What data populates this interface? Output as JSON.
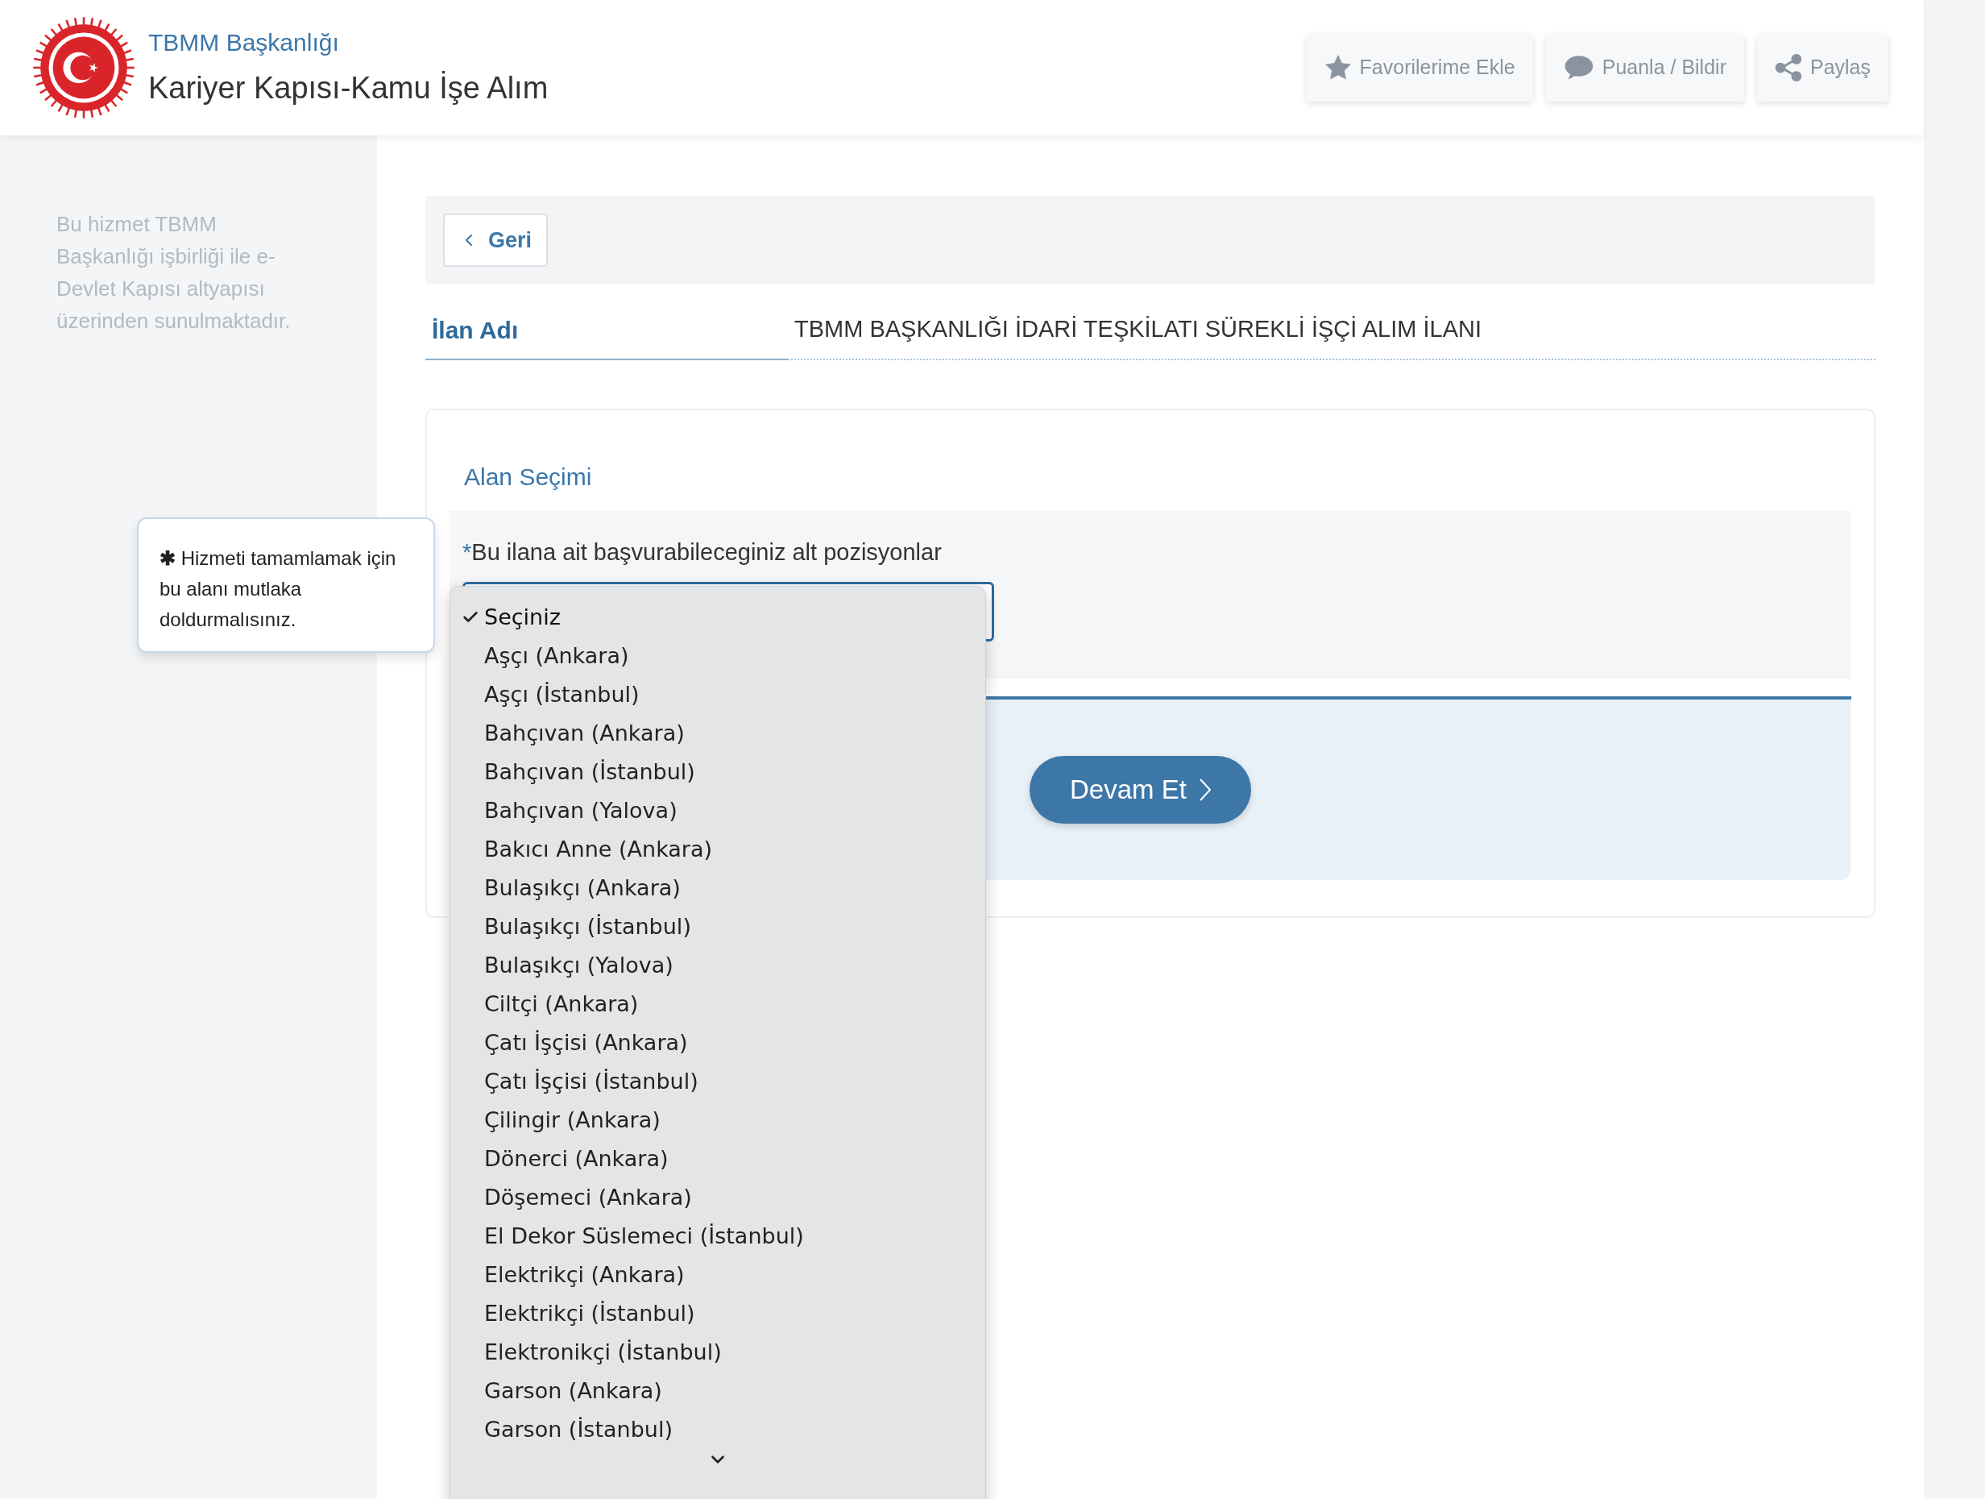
{
  "header": {
    "agency": "TBMM Başkanlığı",
    "title": "Kariyer Kapısı-Kamu İşe Alım",
    "actions": [
      {
        "label": "Favorilerime Ekle",
        "kind": "star"
      },
      {
        "label": "Puanla / Bildir",
        "kind": "comment"
      },
      {
        "label": "Paylaş",
        "kind": "share"
      }
    ]
  },
  "sidebar": {
    "note": "Bu hizmet TBMM Başkanlığı işbirliği ile e-Devlet Kapısı altyapısı üzerinden sunulmaktadır."
  },
  "back_button": {
    "label": "Geri"
  },
  "listing": {
    "label": "İlan Adı",
    "value": "TBMM BAŞKANLIĞI İDARİ TEŞKİLATI SÜREKLİ İŞÇİ ALIM İLANI"
  },
  "section": {
    "title": "Alan Seçimi",
    "required_mark": "*",
    "field_label": "Bu ilana ait başvurabileceginiz alt pozisyonlar"
  },
  "tooltip": {
    "mark": "✱",
    "text": "Hizmeti tamamlamak için bu alanı mutlaka doldurmalısınız."
  },
  "dropdown": {
    "expanded": true,
    "options": [
      {
        "label": "Seçiniz",
        "selected": true
      },
      {
        "label": "Aşçı (Ankara)",
        "selected": false
      },
      {
        "label": "Aşçı (İstanbul)",
        "selected": false
      },
      {
        "label": "Bahçıvan (Ankara)",
        "selected": false
      },
      {
        "label": "Bahçıvan (İstanbul)",
        "selected": false
      },
      {
        "label": "Bahçıvan (Yalova)",
        "selected": false
      },
      {
        "label": "Bakıcı Anne (Ankara)",
        "selected": false
      },
      {
        "label": "Bulaşıkçı (Ankara)",
        "selected": false
      },
      {
        "label": "Bulaşıkçı (İstanbul)",
        "selected": false
      },
      {
        "label": "Bulaşıkçı (Yalova)",
        "selected": false
      },
      {
        "label": "Ciltçi (Ankara)",
        "selected": false
      },
      {
        "label": "Çatı İşçisi (Ankara)",
        "selected": false
      },
      {
        "label": "Çatı İşçisi (İstanbul)",
        "selected": false
      },
      {
        "label": "Çilingir (Ankara)",
        "selected": false
      },
      {
        "label": "Dönerci (Ankara)",
        "selected": false
      },
      {
        "label": "Döşemeci (Ankara)",
        "selected": false
      },
      {
        "label": "El Dekor Süslemeci (İstanbul)",
        "selected": false
      },
      {
        "label": "Elektrikçi (Ankara)",
        "selected": false
      },
      {
        "label": "Elektrikçi (İstanbul)",
        "selected": false
      },
      {
        "label": "Elektronikçi (İstanbul)",
        "selected": false
      },
      {
        "label": "Garson (Ankara)",
        "selected": false
      },
      {
        "label": "Garson (İstanbul)",
        "selected": false
      }
    ]
  },
  "continue_button": {
    "label": "Devam Et"
  }
}
